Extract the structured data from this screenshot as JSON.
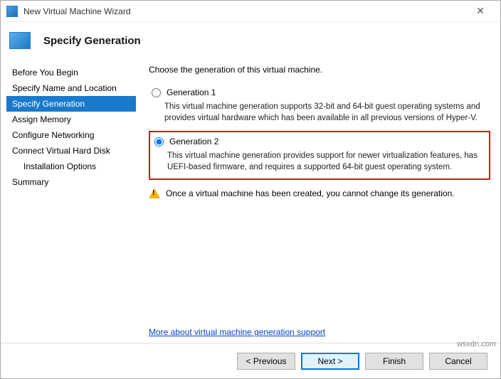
{
  "window": {
    "title": "New Virtual Machine Wizard"
  },
  "header": {
    "title": "Specify Generation"
  },
  "sidebar": {
    "steps": [
      {
        "label": "Before You Begin"
      },
      {
        "label": "Specify Name and Location"
      },
      {
        "label": "Specify Generation",
        "selected": true
      },
      {
        "label": "Assign Memory"
      },
      {
        "label": "Configure Networking"
      },
      {
        "label": "Connect Virtual Hard Disk"
      },
      {
        "label": "Installation Options",
        "indent": true
      },
      {
        "label": "Summary"
      }
    ]
  },
  "content": {
    "prompt": "Choose the generation of this virtual machine.",
    "gen1": {
      "label": "Generation 1",
      "desc": "This virtual machine generation supports 32-bit and 64-bit guest operating systems and provides virtual hardware which has been available in all previous versions of Hyper-V."
    },
    "gen2": {
      "label": "Generation 2",
      "desc": "This virtual machine generation provides support for newer virtualization features, has UEFI-based firmware, and requires a supported 64-bit guest operating system."
    },
    "warning": "Once a virtual machine has been created, you cannot change its generation.",
    "link": "More about virtual machine generation support"
  },
  "footer": {
    "previous": "< Previous",
    "next": "Next >",
    "finish": "Finish",
    "cancel": "Cancel"
  },
  "watermark": "wsxdn.com"
}
